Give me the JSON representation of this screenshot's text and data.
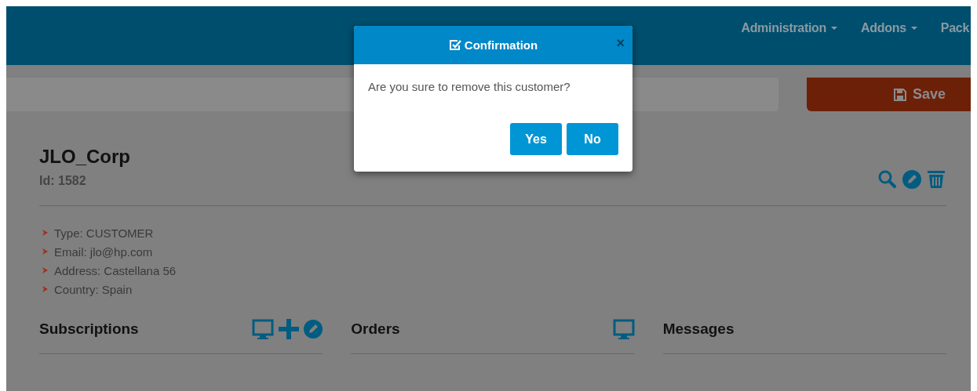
{
  "nav": {
    "items": [
      {
        "label": "Administration",
        "dropdown": true
      },
      {
        "label": "Addons",
        "dropdown": true
      },
      {
        "label": "Pack",
        "dropdown": false
      }
    ]
  },
  "toolbar": {
    "save_button": "Save"
  },
  "customer": {
    "name": "JLO_Corp",
    "id": "Id: 1582",
    "actions": [
      {
        "kind": "search"
      },
      {
        "kind": "edit"
      },
      {
        "kind": "delete"
      }
    ],
    "details": [
      "Type: CUSTOMER",
      "Email: jlo@hp.com",
      "Address: Castellana 56",
      "Country: Spain"
    ]
  },
  "sections": [
    {
      "title": "Subscriptions",
      "actions": [
        {
          "kind": "view"
        },
        {
          "kind": "add"
        },
        {
          "kind": "edit"
        }
      ]
    },
    {
      "title": "Orders",
      "actions": [
        {
          "kind": "view"
        }
      ]
    },
    {
      "title": "Messages"
    }
  ],
  "dialog": {
    "title": "Confirmation",
    "close": "×",
    "message": "Are you sure to remove this customer?",
    "buttons": [
      "Yes",
      "No"
    ]
  }
}
